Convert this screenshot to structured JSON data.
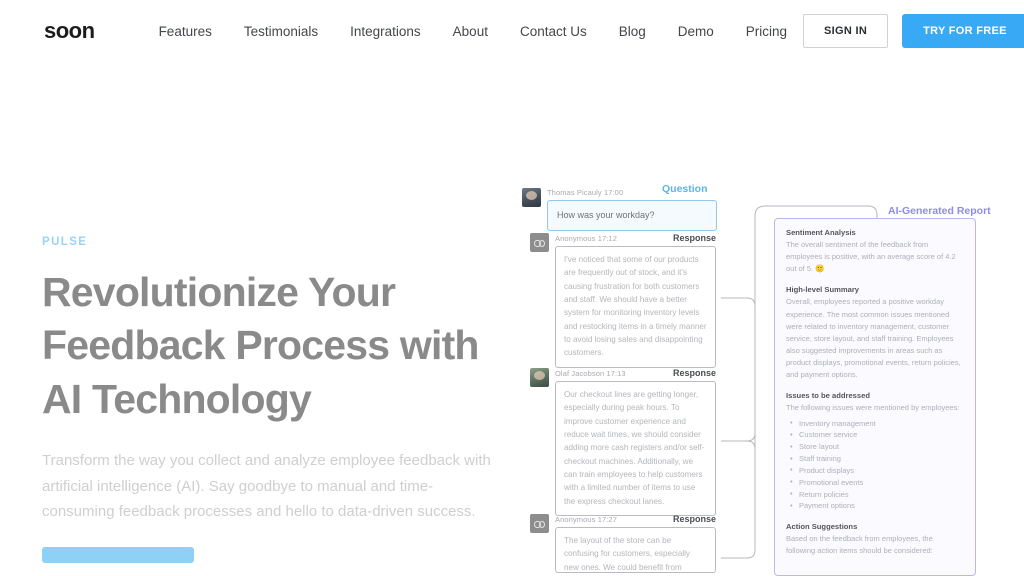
{
  "brand": {
    "logo": "soon"
  },
  "nav": {
    "items": [
      {
        "label": "Features"
      },
      {
        "label": "Testimonials"
      },
      {
        "label": "Integrations"
      },
      {
        "label": "About"
      },
      {
        "label": "Contact Us"
      },
      {
        "label": "Blog"
      },
      {
        "label": "Demo"
      },
      {
        "label": "Pricing"
      }
    ],
    "sign_in": "SIGN IN",
    "try_free": "TRY FOR FREE"
  },
  "hero": {
    "eyebrow": "PULSE",
    "title": "Revolutionize Your Feedback Process with AI Technology",
    "subtitle": "Transform the way you collect and analyze employee feedback with artificial intelligence (AI). Say goodbye to manual and time-consuming feedback processes and hello to data-driven success.",
    "cta_label": ""
  },
  "mockup": {
    "question_label": "Question",
    "response_label": "Response",
    "report_label": "AI-Generated Report",
    "question": {
      "author": "Thomas Picauly",
      "time": "17:00",
      "text": "How was your workday?",
      "avatar": "photo-avatar"
    },
    "responses": [
      {
        "author": "Anonymous",
        "time": "17:12",
        "avatar": "anonymous-avatar",
        "text": "I've noticed that some of our products are frequently out of stock, and it's causing frustration for both customers and staff. We should have a better system for monitoring inventory levels and restocking items in a timely manner to avoid losing sales and disappointing customers."
      },
      {
        "author": "Olaf Jacobson",
        "time": "17:13",
        "avatar": "photo-avatar",
        "text": "Our checkout lines are getting longer, especially during peak hours. To improve customer experience and reduce wait times, we should consider adding more cash registers and/or self-checkout machines. Additionally, we can train employees to help customers with a limited number of items to use the express checkout lanes."
      },
      {
        "author": "Anonymous",
        "time": "17:27",
        "avatar": "anonymous-avatar",
        "text": "The layout of the store can be confusing for customers, especially new ones. We could benefit from clearer signage and better organization to help people find"
      }
    ]
  },
  "report": {
    "sections": [
      {
        "heading": "Sentiment Analysis",
        "body": "The overall sentiment of the feedback from employees is positive, with an average score of 4.2 out of 5. 🙂"
      },
      {
        "heading": "High-level Summary",
        "body": "Overall, employees reported a positive workday experience. The most common issues mentioned were related to inventory management, customer service, store layout, and staff training. Employees also suggested improvements in areas such as product displays, promotional events, return policies, and payment options."
      },
      {
        "heading": "Issues to be addressed",
        "body": "The following issues were mentioned by employees:",
        "items": [
          "Inventory management",
          "Customer service",
          "Store layout",
          "Staff training",
          "Product displays",
          "Promotional events",
          "Return policies",
          "Payment options"
        ]
      },
      {
        "heading": "Action Suggestions",
        "body": "Based on the feedback from employees, the following action items should be considered:"
      }
    ]
  },
  "colors": {
    "accent_blue": "#38aaf5",
    "eyebrow_blue": "#9cd3f5",
    "report_purple": "#8d8ce8",
    "heading_gray": "#8a8a8a"
  }
}
